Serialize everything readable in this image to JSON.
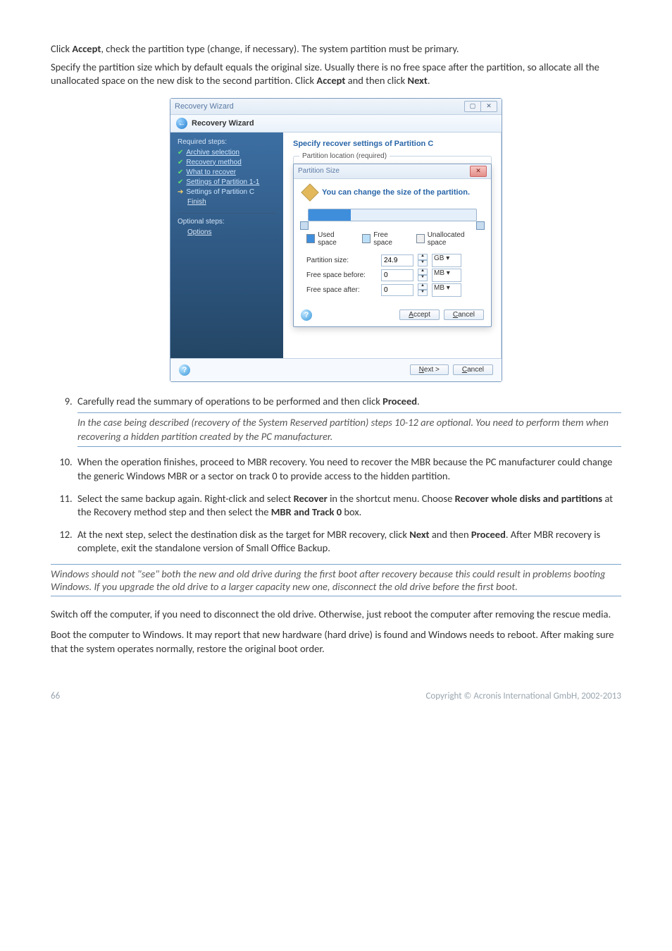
{
  "intro": {
    "p1_a": "Click ",
    "p1_b": "Accept",
    "p1_c": ", check the partition type (change, if necessary). The system partition must be primary.",
    "p2_a": "Specify the partition size which by default equals the original size. Usually there is no free space after the partition, so allocate all the unallocated space on the new disk to the second partition. Click ",
    "p2_b": "Accept",
    "p2_c": " and then click ",
    "p2_d": "Next",
    "p2_e": "."
  },
  "app": {
    "title": "Recovery Wizard",
    "subheader": "Recovery Wizard",
    "sidebar": {
      "required_label": "Required steps:",
      "items": [
        {
          "label": "Archive selection",
          "done": true
        },
        {
          "label": "Recovery method",
          "done": true
        },
        {
          "label": "What to recover",
          "done": true
        },
        {
          "label": "Settings of Partition 1-1",
          "done": true
        }
      ],
      "current": "Settings of Partition C",
      "finish": "Finish",
      "optional_label": "Optional steps:",
      "options": "Options"
    },
    "pane_title": "Specify recover settings of Partition C",
    "fieldset_legend": "Partition location (required)",
    "modal": {
      "title": "Partition Size",
      "message": "You can change the size of the partition.",
      "legend": {
        "used": "Used space",
        "free": "Free space",
        "unalloc": "Unallocated space"
      },
      "rows": {
        "size_label": "Partition size:",
        "size_value": "24.9",
        "size_unit": "GB ▾",
        "before_label": "Free space before:",
        "before_value": "0",
        "before_unit": "MB ▾",
        "after_label": "Free space after:",
        "after_value": "0",
        "after_unit": "MB ▾"
      },
      "accept": "Accept",
      "cancel": "Cancel"
    },
    "footer": {
      "next": "Next >",
      "cancel": "Cancel"
    }
  },
  "list": {
    "s9_a": "Carefully read the summary of operations to be performed and then click ",
    "s9_b": "Proceed",
    "s9_c": ".",
    "s9_note": "In the case being described (recovery of the System Reserved partition) steps 10-12 are optional. You need to perform them when recovering a hidden partition created by the PC manufacturer.",
    "s10": "When the operation finishes, proceed to MBR recovery. You need to recover the MBR because the PC manufacturer could change the generic Windows MBR or a sector on track 0 to provide access to the hidden partition.",
    "s11_a": "Select the same backup again. Right-click and select ",
    "s11_b": "Recover",
    "s11_c": " in the shortcut menu. Choose ",
    "s11_d": "Recover whole disks and partitions",
    "s11_e": " at the Recovery method step and then select the ",
    "s11_f": "MBR and Track 0",
    "s11_g": " box.",
    "s12_a": "At the next step, select the destination disk as the target for MBR recovery, click ",
    "s12_b": "Next",
    "s12_c": " and then ",
    "s12_d": "Proceed",
    "s12_e": ". After MBR recovery is complete, exit the standalone version of Small Office Backup."
  },
  "outer_note": "Windows should not \"see\" both the new and old drive during the first boot after recovery because this could result in problems booting Windows. If you upgrade the old drive to a larger capacity new one, disconnect the old drive before the first boot.",
  "tail": {
    "p1": "Switch off the computer, if you need to disconnect the old drive. Otherwise, just reboot the computer after removing the rescue media.",
    "p2": "Boot the computer to Windows. It may report that new hardware (hard drive) is found and Windows needs to reboot. After making sure that the system operates normally, restore the original boot order."
  },
  "footer": {
    "page": "66",
    "copyright": "Copyright © Acronis International GmbH, 2002-2013"
  }
}
